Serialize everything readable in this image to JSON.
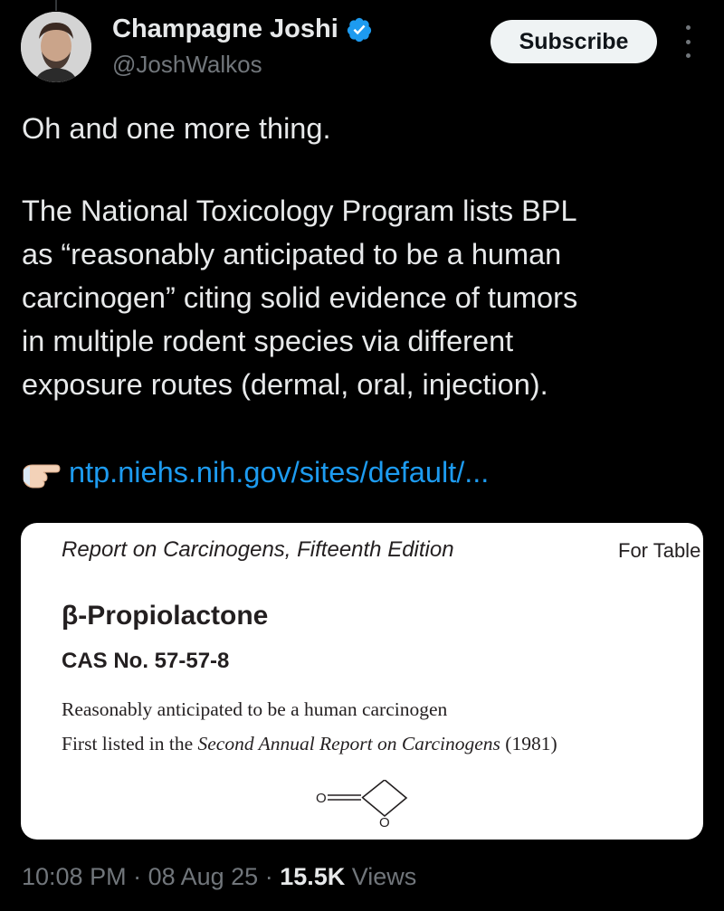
{
  "author": {
    "name": "Champagne Joshi",
    "handle": "@JoshWalkos"
  },
  "subscribe_label": "Subscribe",
  "tweet": {
    "lines": [
      "Oh and one more thing.",
      "The National Toxicology Program lists BPL",
      "as “reasonably anticipated to be a human",
      "carcinogen” citing solid evidence of tumors",
      "in multiple rodent species via different",
      "exposure routes (dermal, oral, injection)."
    ],
    "link_text": "ntp.niehs.nih.gov/sites/default/..."
  },
  "card": {
    "header": "Report on Carcinogens, Fifteenth Edition",
    "for_text": "For Table",
    "title": "β-Propiolactone",
    "cas": "CAS No. 57-57-8",
    "line1": "Reasonably anticipated to be a human carcinogen",
    "line2_prefix": "First listed in the ",
    "line2_italic": "Second Annual Report on Carcinogens",
    "line2_suffix": " (1981)",
    "structure_atom_1": "O",
    "structure_atom_2": "O"
  },
  "meta": {
    "time": "10:08 PM",
    "separator": " · ",
    "date": "08 Aug 25",
    "views_count": "15.5K",
    "views_label": " Views"
  },
  "colors": {
    "background": "#000000",
    "text": "#e7e9ea",
    "muted": "#71767b",
    "link": "#1d9bf0",
    "verified": "#1d9bf0"
  }
}
